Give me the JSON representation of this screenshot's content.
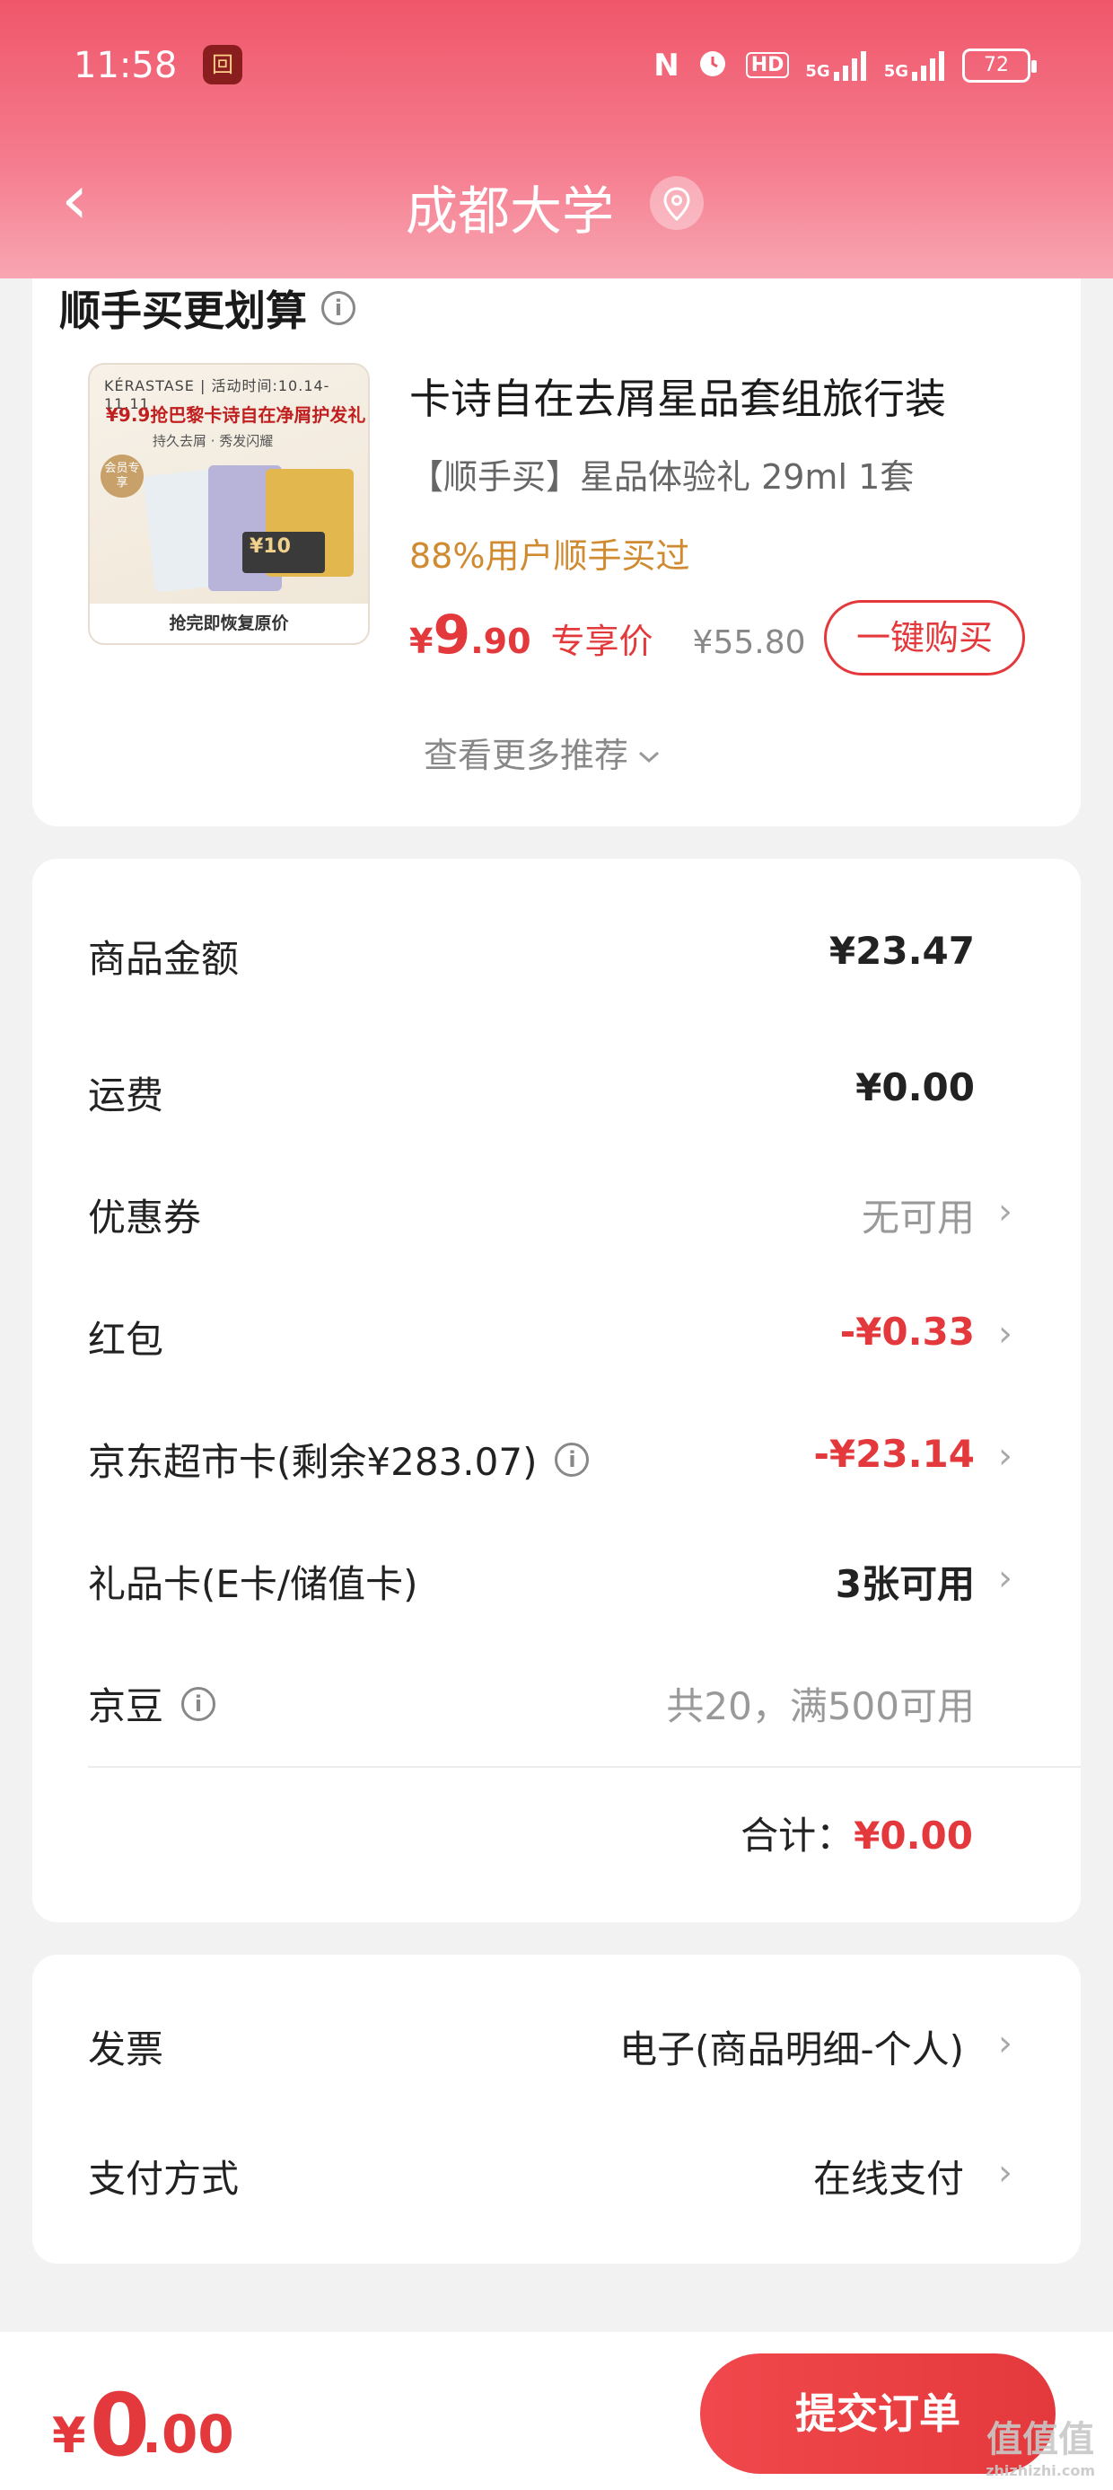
{
  "status_bar": {
    "time": "11:58",
    "app_badge": "回",
    "nfc": "N",
    "hd": "HD",
    "signal1": "5G",
    "signal2": "5G",
    "battery": "72"
  },
  "nav": {
    "back": "‹",
    "title": "成都大学"
  },
  "upsell": {
    "title": "顺手买更划算",
    "image": {
      "brand": "KÉRASTASE | 活动时间:10.14-11.11",
      "headline": "¥9.9抢巴黎卡诗自在净屑护发礼",
      "sub": "持久去屑 · 秀发闪耀",
      "tag": "会员专享",
      "coupon": "¥10",
      "footer": "抢完即恢复原价"
    },
    "product_name": "卡诗自在去屑星品套组旅行装",
    "product_desc": "【顺手买】星品体验礼 29ml 1套",
    "social_proof": "88%用户顺手买过",
    "price_symbol": "¥",
    "price_int": "9",
    "price_dec": ".90",
    "price_label": "专享价",
    "original_price": "¥55.80",
    "buy_button": "一键购买",
    "more": "查看更多推荐"
  },
  "summary": {
    "rows": [
      {
        "label": "商品金额",
        "value": "¥23.47"
      },
      {
        "label": "运费",
        "value": "¥0.00"
      },
      {
        "label": "优惠券",
        "value": "无可用"
      },
      {
        "label": "红包",
        "value": "-¥0.33"
      },
      {
        "label": "京东超市卡(剩余¥283.07)",
        "value": "-¥23.14"
      },
      {
        "label": "礼品卡(E卡/储值卡)",
        "value": "3张可用"
      },
      {
        "label": "京豆",
        "value": "共20，满500可用"
      }
    ],
    "total_label": "合计：",
    "total_value": "¥0.00"
  },
  "options": {
    "invoice_label": "发票",
    "invoice_value": "电子(商品明细-个人)",
    "payment_label": "支付方式",
    "payment_value": "在线支付"
  },
  "bottom": {
    "yen": "¥",
    "amount_int": "0",
    "amount_dec": ".00",
    "submit": "提交订单"
  },
  "watermark": {
    "text": "值值值",
    "sub": "zhizhizhi.com"
  },
  "colors": {
    "accent": "#e4393c",
    "header": "#f0566a",
    "social": "#d08a30"
  }
}
